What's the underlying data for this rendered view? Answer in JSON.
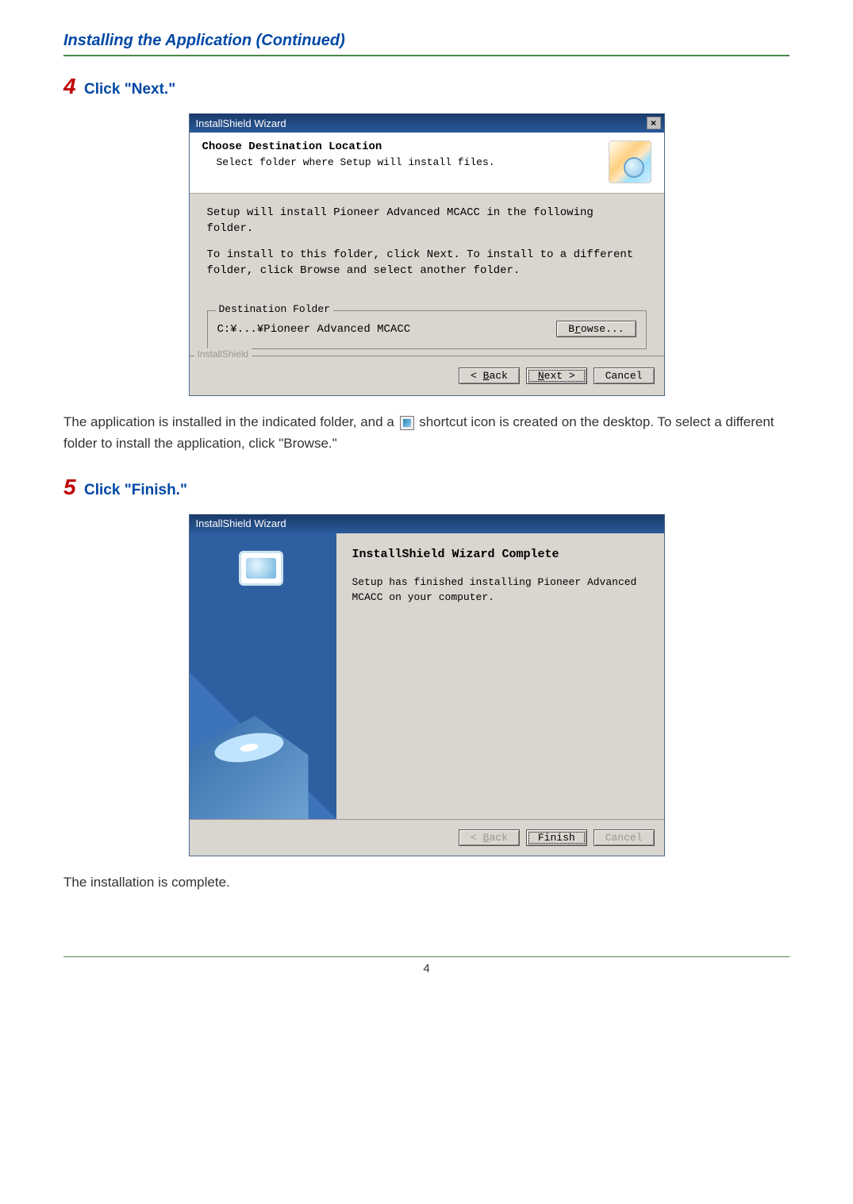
{
  "section_title": "Installing the Application (Continued)",
  "step4": {
    "num": "4",
    "text": "Click \"Next.\""
  },
  "step5": {
    "num": "5",
    "text": "Click \"Finish.\""
  },
  "dialog1": {
    "title": "InstallShield Wizard",
    "header_title": "Choose Destination Location",
    "header_sub": "Select folder where Setup will install files.",
    "line1": "Setup will install Pioneer Advanced MCACC in the following folder.",
    "line2": "To install to this folder, click Next. To install to a different folder, click Browse and select another folder.",
    "dest_legend": "Destination Folder",
    "dest_path": "C:¥...¥Pioneer Advanced MCACC",
    "browse_btn_pre": "B",
    "browse_btn_u": "r",
    "browse_btn_post": "owse...",
    "footer_label": "InstallShield",
    "back_pre": "< ",
    "back_u": "B",
    "back_post": "ack",
    "next_u": "N",
    "next_post": "ext >",
    "cancel": "Cancel",
    "close_x": "×"
  },
  "para1": "The application is installed in the indicated folder, and a ",
  "para1_b": " shortcut icon is created on the desktop. To select a different folder to install the application, click \"Browse.\"",
  "dialog2": {
    "title": "InstallShield Wizard",
    "heading": "InstallShield Wizard Complete",
    "text": "Setup has finished installing Pioneer Advanced MCACC on your computer.",
    "back_pre": "< ",
    "back_u": "B",
    "back_post": "ack",
    "finish": "Finish",
    "cancel": "Cancel"
  },
  "para2": "The installation is complete.",
  "page_num": "4"
}
